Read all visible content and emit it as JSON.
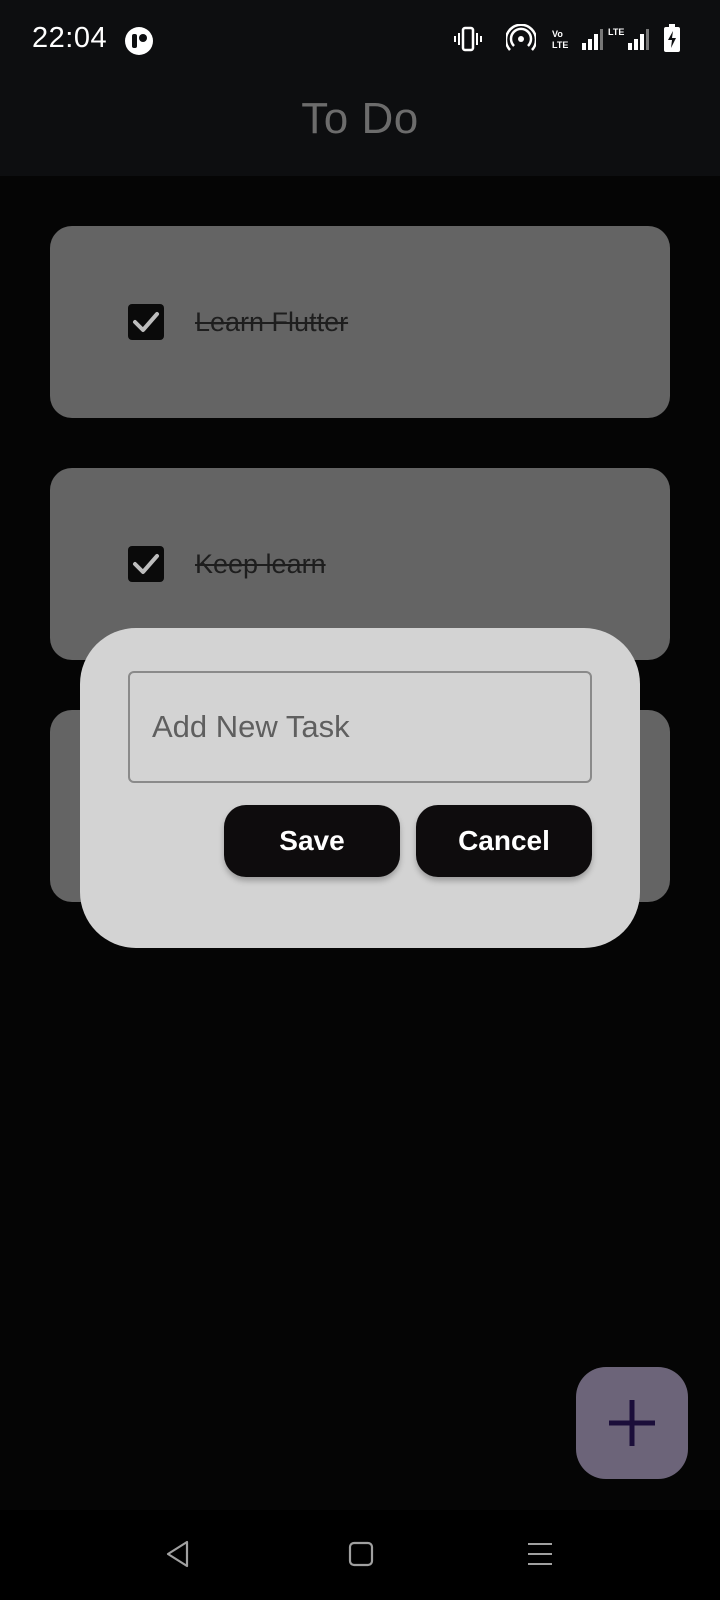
{
  "status_bar": {
    "time": "22:04",
    "icons": [
      "app-notification-icon",
      "vibrate-icon",
      "hotspot-icon",
      "volte-icon",
      "signal-icon",
      "lte-signal-icon",
      "battery-charging-icon"
    ],
    "volte_text": "Vo LTE",
    "lte_text": "LTE"
  },
  "app_bar": {
    "title": "To Do"
  },
  "tasks": [
    {
      "label": "Learn Flutter",
      "completed": true
    },
    {
      "label": "Keep learn",
      "completed": true
    }
  ],
  "dialog": {
    "input_placeholder": "Add New Task",
    "input_value": "",
    "save_label": "Save",
    "cancel_label": "Cancel"
  },
  "fab": {
    "icon": "plus-icon"
  },
  "nav_bar": {
    "icons": [
      "back-icon",
      "home-icon",
      "menu-icon"
    ]
  },
  "colors": {
    "background": "#050505",
    "card": "#646464",
    "dialog": "#d3d3d3",
    "button": "#0e0c0d",
    "fab": "#6c6479",
    "fab_icon": "#1b0e3a"
  }
}
